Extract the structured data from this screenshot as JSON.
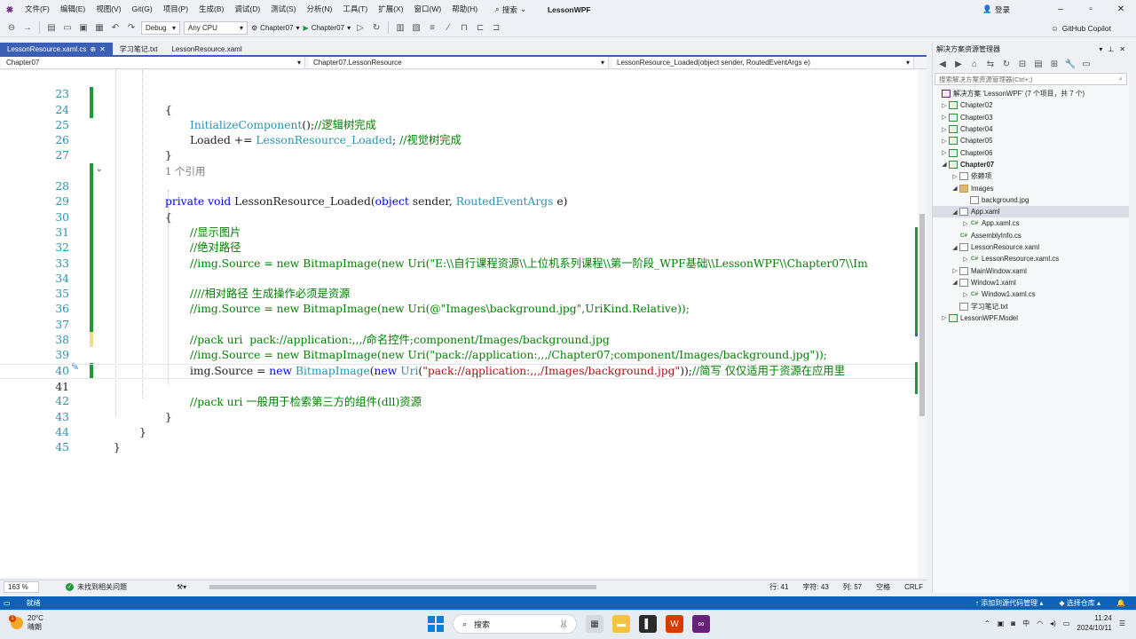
{
  "menubar": {
    "items": [
      "文件(F)",
      "编辑(E)",
      "视图(V)",
      "Git(G)",
      "项目(P)",
      "生成(B)",
      "调试(D)",
      "测试(S)",
      "分析(N)",
      "工具(T)",
      "扩展(X)",
      "窗口(W)",
      "帮助(H)"
    ],
    "search_label": "搜索",
    "solution_title": "LessonWPF",
    "login_label": "登录"
  },
  "toolbar": {
    "config": "Debug",
    "platform": "Any CPU",
    "startup_project": "Chapter07",
    "run_target": "Chapter07",
    "copilot_label": "GitHub Copilot"
  },
  "doc_tabs": [
    {
      "label": "LessonResource.xaml.cs",
      "active": true
    },
    {
      "label": "学习笔记.txt",
      "active": false
    },
    {
      "label": "LessonResource.xaml",
      "active": false
    }
  ],
  "nav": {
    "project": "Chapter07",
    "class": "Chapter07.LessonResource",
    "member": "LessonResource_Loaded(object sender, RoutedEventArgs e)"
  },
  "editor": {
    "lines": [
      {
        "n": "23",
        "text": "{"
      },
      {
        "n": "24",
        "text": "InitializeComponent();//逻辑树完成"
      },
      {
        "n": "25",
        "text": "Loaded += LessonResource_Loaded; //视觉树完成"
      },
      {
        "n": "26",
        "text": "}"
      },
      {
        "n": "27",
        "text": ""
      },
      {
        "n": "",
        "text": "1 个引用"
      },
      {
        "n": "28",
        "text": "private void LessonResource_Loaded(object sender, RoutedEventArgs e)"
      },
      {
        "n": "29",
        "text": "{"
      },
      {
        "n": "30",
        "text": "//显示图片"
      },
      {
        "n": "31",
        "text": "//绝对路径"
      },
      {
        "n": "32",
        "text": "//img.Source = new BitmapImage(new Uri(\"E:\\\\自行课程资源\\\\上位机系列课程\\\\第一阶段_WPF基础\\\\LessonWPF\\\\Chapter07\\\\Im"
      },
      {
        "n": "33",
        "text": ""
      },
      {
        "n": "34",
        "text": "////相对路径 生成操作必须是资源"
      },
      {
        "n": "35",
        "text": "//img.Source = new BitmapImage(new Uri(@\"Images\\background.jpg\",UriKind.Relative));"
      },
      {
        "n": "36",
        "text": ""
      },
      {
        "n": "37",
        "text": "//pack uri  pack://application:,,,/命名控件;component/Images/background.jpg"
      },
      {
        "n": "38",
        "text": "//img.Source = new BitmapImage(new Uri(\"pack://application:,,,/Chapter07;component/Images/background.jpg\"));"
      },
      {
        "n": "39",
        "text": "img.Source = new BitmapImage(new Uri(\"pack://application:,,,/Images/background.jpg\"));//简写 仅仅适用于资源在应用里"
      },
      {
        "n": "40",
        "text": ""
      },
      {
        "n": "41",
        "text": "//pack uri 一般用于检索第三方的组件(dll)资源"
      },
      {
        "n": "42",
        "text": "}"
      },
      {
        "n": "43",
        "text": "}"
      },
      {
        "n": "44",
        "text": "}"
      },
      {
        "n": "45",
        "text": ""
      }
    ]
  },
  "editor_status": {
    "zoom": "163 %",
    "issues": "未找到相关问题",
    "line": "行: 41",
    "char": "字符: 43",
    "col": "列: 57",
    "whitespace": "空格",
    "eol": "CRLF"
  },
  "solution_explorer": {
    "title": "解决方案资源管理器",
    "search_placeholder": "搜索解决方案资源管理器(Ctrl+;)",
    "solution_label": "解决方案 'LessonWPF' (7 个项目，共 7 个)",
    "tree": [
      {
        "label": "Chapter02",
        "depth": 1,
        "icon": "proj",
        "arrow": "▷"
      },
      {
        "label": "Chapter03",
        "depth": 1,
        "icon": "proj",
        "arrow": "▷"
      },
      {
        "label": "Chapter04",
        "depth": 1,
        "icon": "proj",
        "arrow": "▷"
      },
      {
        "label": "Chapter05",
        "depth": 1,
        "icon": "proj",
        "arrow": "▷"
      },
      {
        "label": "Chapter06",
        "depth": 1,
        "icon": "proj",
        "arrow": "▷"
      },
      {
        "label": "Chapter07",
        "depth": 1,
        "icon": "proj",
        "arrow": "◢",
        "bold": true
      },
      {
        "label": "依赖项",
        "depth": 2,
        "icon": "file",
        "arrow": "▷"
      },
      {
        "label": "Images",
        "depth": 2,
        "icon": "folder",
        "arrow": "◢"
      },
      {
        "label": "background.jpg",
        "depth": 3,
        "icon": "file",
        "arrow": ""
      },
      {
        "label": "App.xaml",
        "depth": 2,
        "icon": "file",
        "arrow": "◢",
        "selected": true
      },
      {
        "label": "App.xaml.cs",
        "depth": 3,
        "icon": "cs",
        "arrow": "▷"
      },
      {
        "label": "AssemblyInfo.cs",
        "depth": 2,
        "icon": "cs",
        "arrow": ""
      },
      {
        "label": "LessonResource.xaml",
        "depth": 2,
        "icon": "file",
        "arrow": "◢"
      },
      {
        "label": "LessonResource.xaml.cs",
        "depth": 3,
        "icon": "cs",
        "arrow": "▷"
      },
      {
        "label": "MainWindow.xaml",
        "depth": 2,
        "icon": "file",
        "arrow": "▷"
      },
      {
        "label": "Window1.xaml",
        "depth": 2,
        "icon": "file",
        "arrow": "◢"
      },
      {
        "label": "Window1.xaml.cs",
        "depth": 3,
        "icon": "cs",
        "arrow": "▷"
      },
      {
        "label": "学习笔记.txt",
        "depth": 2,
        "icon": "file",
        "arrow": ""
      },
      {
        "label": "LessonWPF.Model",
        "depth": 1,
        "icon": "proj",
        "arrow": "▷"
      }
    ]
  },
  "statusbar": {
    "ready": "就绪",
    "add_source": "添加到源代码管理",
    "select_repo": "选择仓库"
  },
  "taskbar": {
    "temperature": "20°C",
    "weather": "晴朗",
    "search_label": "搜索",
    "time": "11:24",
    "date": "2024/10/11",
    "weather_badge": "1"
  },
  "colors": {
    "accent": "#3b5fb4",
    "status_bar": "#0e63b8",
    "keyword": "#0000ff",
    "type": "#2b91af",
    "comment": "#008000",
    "string": "#a31515",
    "change_bar": "#1a9a3a"
  }
}
